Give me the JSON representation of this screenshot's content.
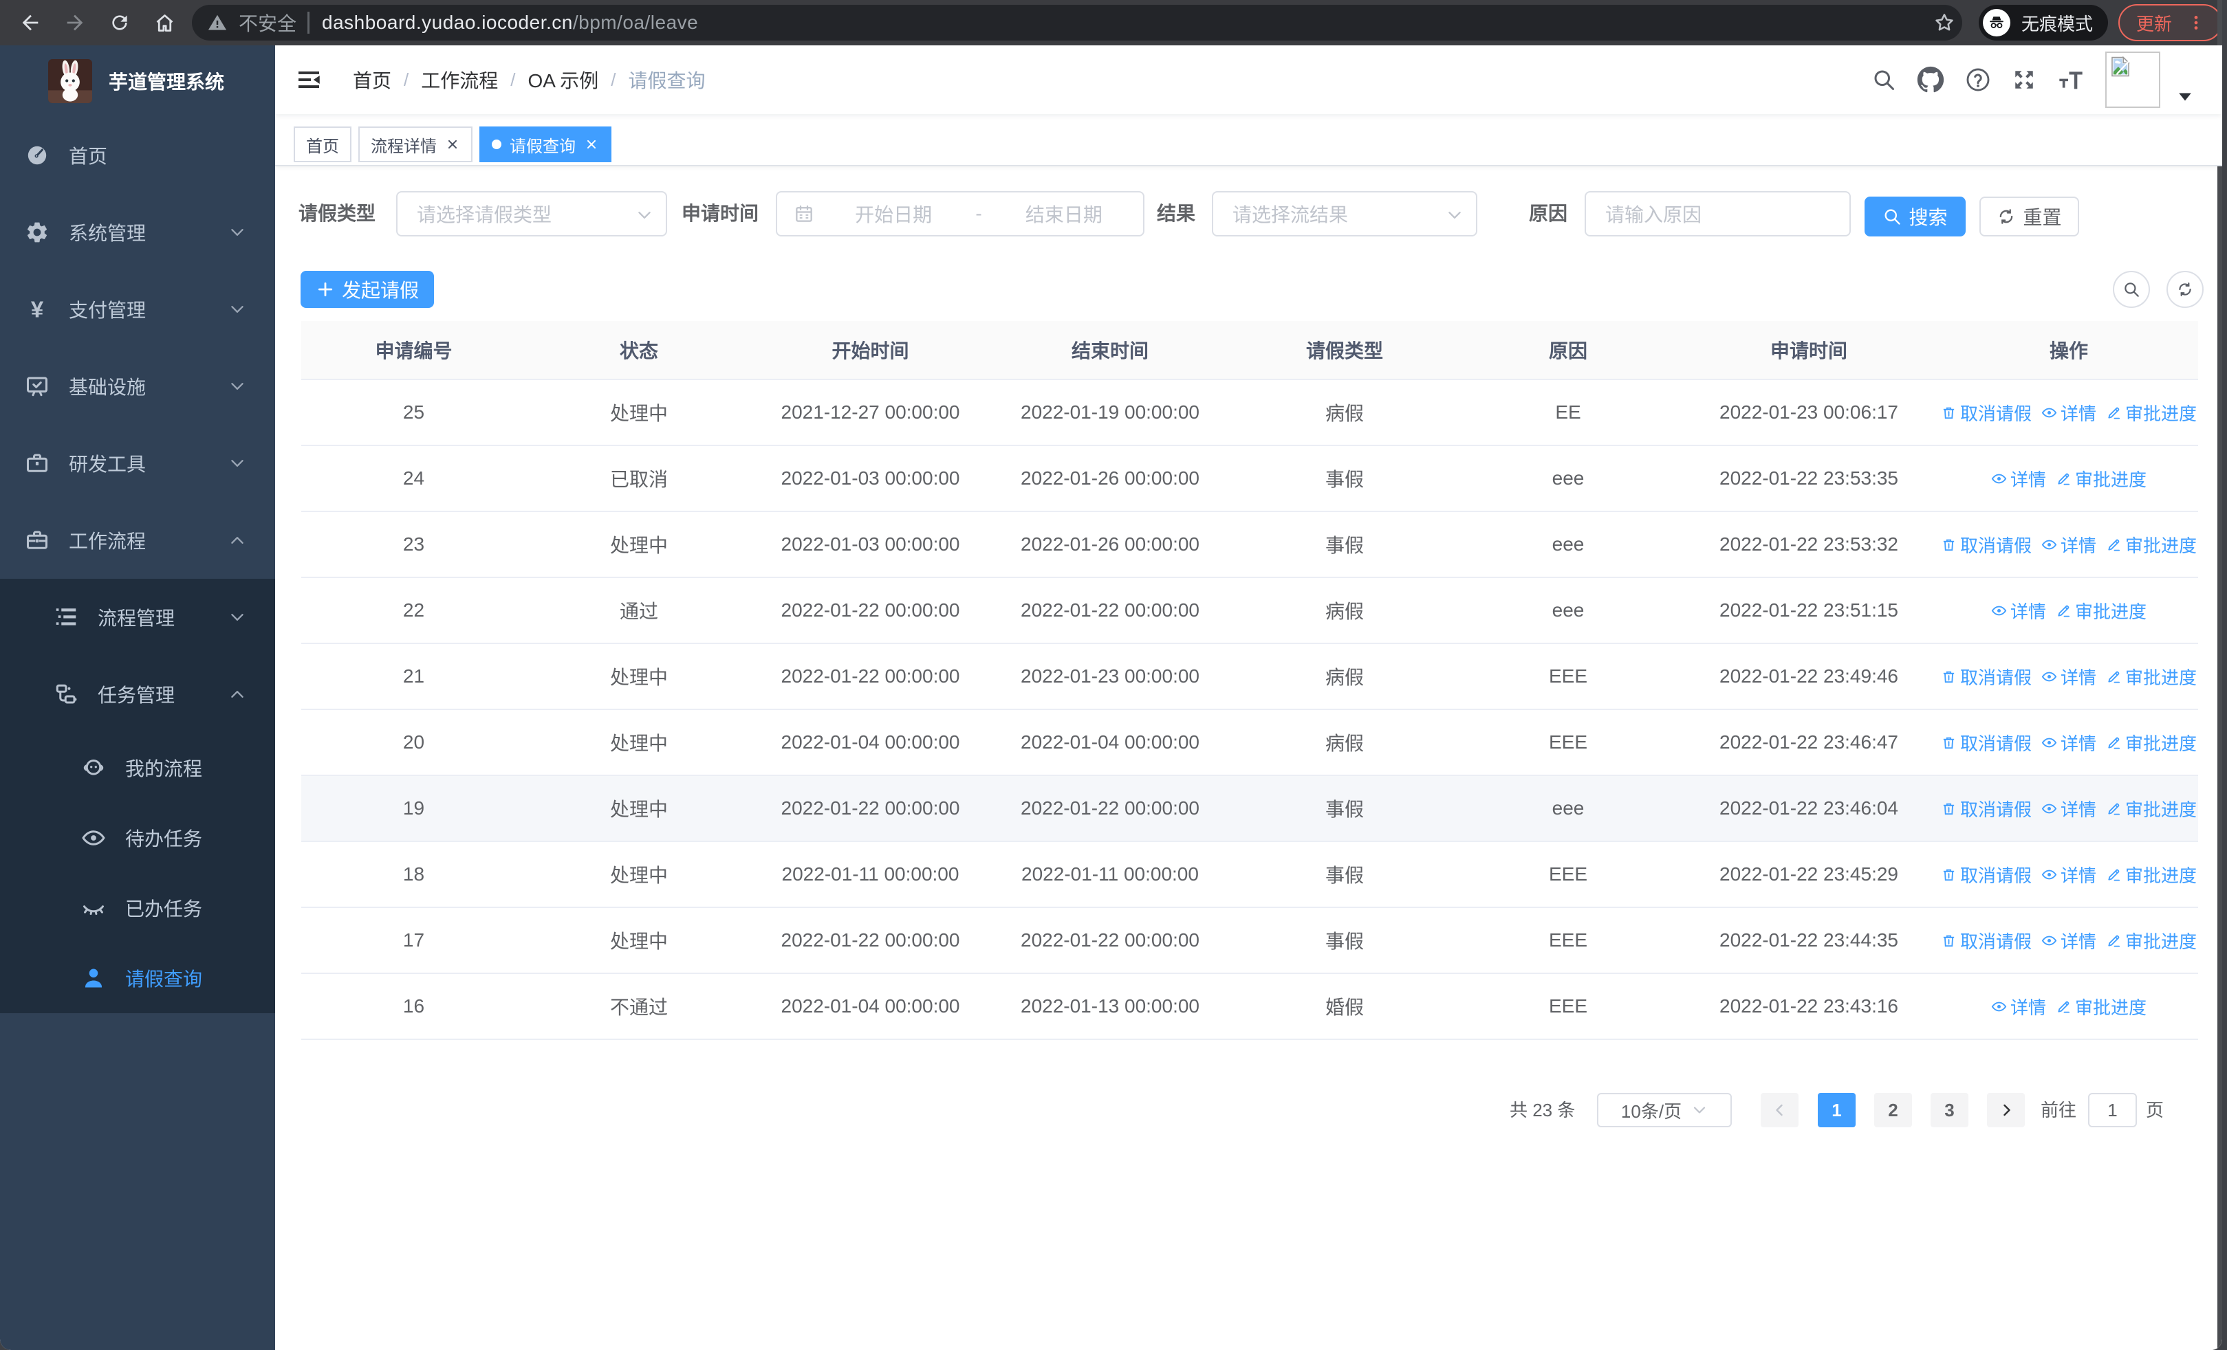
{
  "browser": {
    "security_label": "不安全",
    "url_domain": "dashboard.yudao.iocoder.cn",
    "url_path": "/bpm/oa/leave",
    "incognito_label": "无痕模式",
    "update_label": "更新"
  },
  "sidebar": {
    "title": "芋道管理系统",
    "items": [
      {
        "label": "首页",
        "icon": "gauge",
        "arrow": ""
      },
      {
        "label": "系统管理",
        "icon": "gear",
        "arrow": "down"
      },
      {
        "label": "支付管理",
        "icon": "yen",
        "arrow": "down"
      },
      {
        "label": "基础设施",
        "icon": "monitor",
        "arrow": "down"
      },
      {
        "label": "研发工具",
        "icon": "toolbox",
        "arrow": "down"
      },
      {
        "label": "工作流程",
        "icon": "briefcase",
        "arrow": "up"
      }
    ],
    "submenu": [
      {
        "label": "流程管理",
        "icon": "treelist",
        "arrow": "down",
        "level": 2
      },
      {
        "label": "任务管理",
        "icon": "org",
        "arrow": "up",
        "level": 2
      },
      {
        "label": "我的流程",
        "icon": "people",
        "arrow": "",
        "level": 3
      },
      {
        "label": "待办任务",
        "icon": "eye",
        "arrow": "",
        "level": 3
      },
      {
        "label": "已办任务",
        "icon": "eyeclosed",
        "arrow": "",
        "level": 3
      },
      {
        "label": "请假查询",
        "icon": "user",
        "arrow": "",
        "level": 3,
        "active": true
      }
    ]
  },
  "header": {
    "breadcrumb": [
      "首页",
      "工作流程",
      "OA 示例",
      "请假查询"
    ],
    "separator": "/"
  },
  "tabs": [
    {
      "label": "首页",
      "closable": false,
      "active": false
    },
    {
      "label": "流程详情",
      "closable": true,
      "active": false
    },
    {
      "label": "请假查询",
      "closable": true,
      "active": true
    }
  ],
  "filters": {
    "leave_type": {
      "label": "请假类型",
      "placeholder": "请选择请假类型"
    },
    "apply_time": {
      "label": "申请时间",
      "start_placeholder": "开始日期",
      "separator": "-",
      "end_placeholder": "结束日期"
    },
    "result": {
      "label": "结果",
      "placeholder": "请选择流结果"
    },
    "reason": {
      "label": "原因",
      "placeholder": "请输入原因"
    },
    "search_label": "搜索",
    "reset_label": "重置"
  },
  "toolbar": {
    "create_label": "发起请假"
  },
  "table": {
    "columns": [
      "申请编号",
      "状态",
      "开始时间",
      "结束时间",
      "请假类型",
      "原因",
      "申请时间",
      "操作"
    ],
    "action_labels": {
      "cancel": "取消请假",
      "detail": "详情",
      "progress": "审批进度"
    },
    "rows": [
      {
        "id": "25",
        "status": "处理中",
        "start": "2021-12-27 00:00:00",
        "end": "2022-01-19 00:00:00",
        "type": "病假",
        "reason": "EE",
        "apply_time": "2022-01-23 00:06:17",
        "cancellable": true,
        "highlighted": false
      },
      {
        "id": "24",
        "status": "已取消",
        "start": "2022-01-03 00:00:00",
        "end": "2022-01-26 00:00:00",
        "type": "事假",
        "reason": "eee",
        "apply_time": "2022-01-22 23:53:35",
        "cancellable": false,
        "highlighted": false
      },
      {
        "id": "23",
        "status": "处理中",
        "start": "2022-01-03 00:00:00",
        "end": "2022-01-26 00:00:00",
        "type": "事假",
        "reason": "eee",
        "apply_time": "2022-01-22 23:53:32",
        "cancellable": true,
        "highlighted": false
      },
      {
        "id": "22",
        "status": "通过",
        "start": "2022-01-22 00:00:00",
        "end": "2022-01-22 00:00:00",
        "type": "病假",
        "reason": "eee",
        "apply_time": "2022-01-22 23:51:15",
        "cancellable": false,
        "highlighted": false
      },
      {
        "id": "21",
        "status": "处理中",
        "start": "2022-01-22 00:00:00",
        "end": "2022-01-23 00:00:00",
        "type": "病假",
        "reason": "EEE",
        "apply_time": "2022-01-22 23:49:46",
        "cancellable": true,
        "highlighted": false
      },
      {
        "id": "20",
        "status": "处理中",
        "start": "2022-01-04 00:00:00",
        "end": "2022-01-04 00:00:00",
        "type": "病假",
        "reason": "EEE",
        "apply_time": "2022-01-22 23:46:47",
        "cancellable": true,
        "highlighted": false
      },
      {
        "id": "19",
        "status": "处理中",
        "start": "2022-01-22 00:00:00",
        "end": "2022-01-22 00:00:00",
        "type": "事假",
        "reason": "eee",
        "apply_time": "2022-01-22 23:46:04",
        "cancellable": true,
        "highlighted": true
      },
      {
        "id": "18",
        "status": "处理中",
        "start": "2022-01-11 00:00:00",
        "end": "2022-01-11 00:00:00",
        "type": "事假",
        "reason": "EEE",
        "apply_time": "2022-01-22 23:45:29",
        "cancellable": true,
        "highlighted": false
      },
      {
        "id": "17",
        "status": "处理中",
        "start": "2022-01-22 00:00:00",
        "end": "2022-01-22 00:00:00",
        "type": "事假",
        "reason": "EEE",
        "apply_time": "2022-01-22 23:44:35",
        "cancellable": true,
        "highlighted": false
      },
      {
        "id": "16",
        "status": "不通过",
        "start": "2022-01-04 00:00:00",
        "end": "2022-01-13 00:00:00",
        "type": "婚假",
        "reason": "EEE",
        "apply_time": "2022-01-22 23:43:16",
        "cancellable": false,
        "highlighted": false
      }
    ]
  },
  "pagination": {
    "total_label": "共 23 条",
    "page_size_label": "10条/页",
    "pages": [
      "1",
      "2",
      "3"
    ],
    "active_page": "1",
    "goto_label": "前往",
    "goto_value": "1",
    "unit_label": "页"
  },
  "colors": {
    "primary": "#409EFF",
    "sidebar_bg": "#304156",
    "submenu_bg": "#1f2d3d",
    "sidebar_text": "#bfcbd9",
    "update_accent": "#ee675c",
    "table_header_bg": "#fafafa",
    "row_hover_bg": "#f5f7fa"
  }
}
